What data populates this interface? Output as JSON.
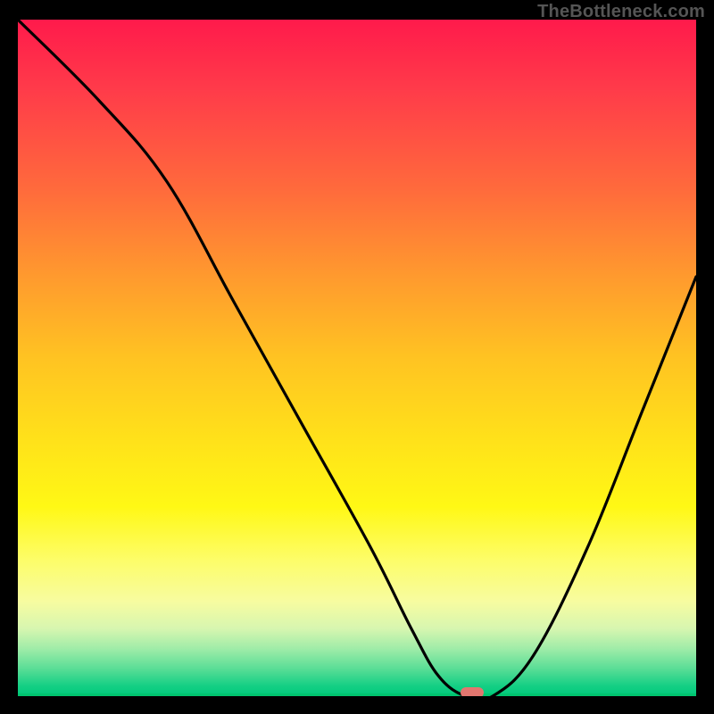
{
  "watermark": "TheBottleneck.com",
  "chart_data": {
    "type": "line",
    "title": "",
    "xlabel": "",
    "ylabel": "",
    "xlim": [
      0,
      100
    ],
    "ylim": [
      0,
      100
    ],
    "grid": false,
    "legend": false,
    "series": [
      {
        "name": "bottleneck-curve",
        "x": [
          0,
          12,
          22,
          32,
          42,
          52,
          58,
          62,
          66,
          70,
          76,
          84,
          92,
          100
        ],
        "values": [
          100,
          88,
          76,
          58,
          40,
          22,
          10,
          3,
          0,
          0,
          6,
          22,
          42,
          62
        ]
      }
    ],
    "marker": {
      "x": 67,
      "y": 0.5,
      "color": "#e2766f"
    },
    "gradient_stops": [
      {
        "pos": 0,
        "color": "#ff1a4b"
      },
      {
        "pos": 0.5,
        "color": "#ffc322"
      },
      {
        "pos": 0.8,
        "color": "#fdfd6a"
      },
      {
        "pos": 0.96,
        "color": "#58dd96"
      },
      {
        "pos": 1.0,
        "color": "#00c97c"
      }
    ]
  }
}
